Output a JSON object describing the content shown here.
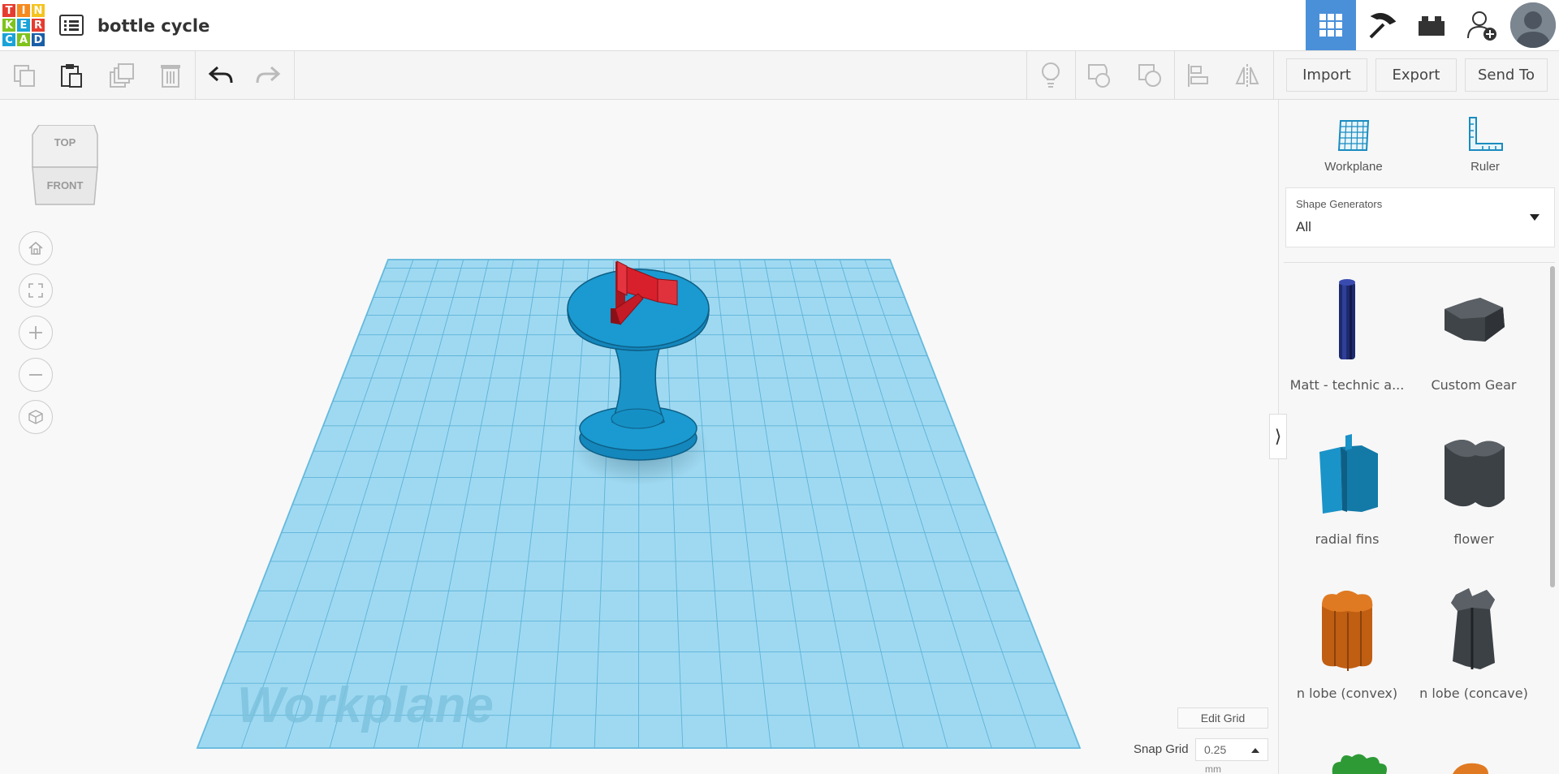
{
  "header": {
    "logo_letters": [
      "T",
      "I",
      "N",
      "K",
      "E",
      "R",
      "C",
      "A",
      "D"
    ],
    "logo_colors": [
      "#e63c2f",
      "#f58a1f",
      "#f5c31f",
      "#7fc31c",
      "#1aa3d9",
      "#e63c2f",
      "#1aa3d9",
      "#7fc31c",
      "#1a5ea8"
    ],
    "project_title": "bottle cycle",
    "icons": [
      "menu-list-icon",
      "3d-design-icon",
      "codeblocks-icon",
      "bricks-icon",
      "add-user-icon",
      "avatar"
    ]
  },
  "toolbar": {
    "left_icons": [
      "copy-icon",
      "paste-icon",
      "duplicate-icon",
      "delete-icon",
      "undo-icon",
      "redo-icon"
    ],
    "right_icons": [
      "lightbulb-icon",
      "group-icon",
      "ungroup-icon",
      "align-icon",
      "mirror-icon"
    ],
    "import_label": "Import",
    "export_label": "Export",
    "sendto_label": "Send To"
  },
  "viewcube": {
    "top_label": "TOP",
    "front_label": "FRONT"
  },
  "nav_icons": [
    "home-view-icon",
    "fit-view-icon",
    "zoom-in-icon",
    "zoom-out-icon",
    "perspective-icon"
  ],
  "workplane": {
    "watermark": "Workplane",
    "plane_color": "#8fd3ef",
    "model_color": "#1a93c8",
    "fin_color": "#d8202c"
  },
  "grid_controls": {
    "edit_grid_label": "Edit Grid",
    "snap_grid_label": "Snap Grid",
    "snap_value": "0.25",
    "snap_unit": "mm"
  },
  "panel": {
    "workplane_label": "Workplane",
    "ruler_label": "Ruler",
    "shape_generators_label": "Shape Generators",
    "shape_generators_value": "All",
    "shapes": [
      {
        "label": "Matt - technic a...",
        "icon": "technic-axle-icon"
      },
      {
        "label": "Custom Gear",
        "icon": "gear-shape-icon"
      },
      {
        "label": "radial fins",
        "icon": "radial-fins-icon"
      },
      {
        "label": "flower",
        "icon": "flower-shape-icon"
      },
      {
        "label": "n lobe (convex)",
        "icon": "lobe-convex-icon"
      },
      {
        "label": "n lobe (concave)",
        "icon": "lobe-concave-icon"
      }
    ]
  }
}
